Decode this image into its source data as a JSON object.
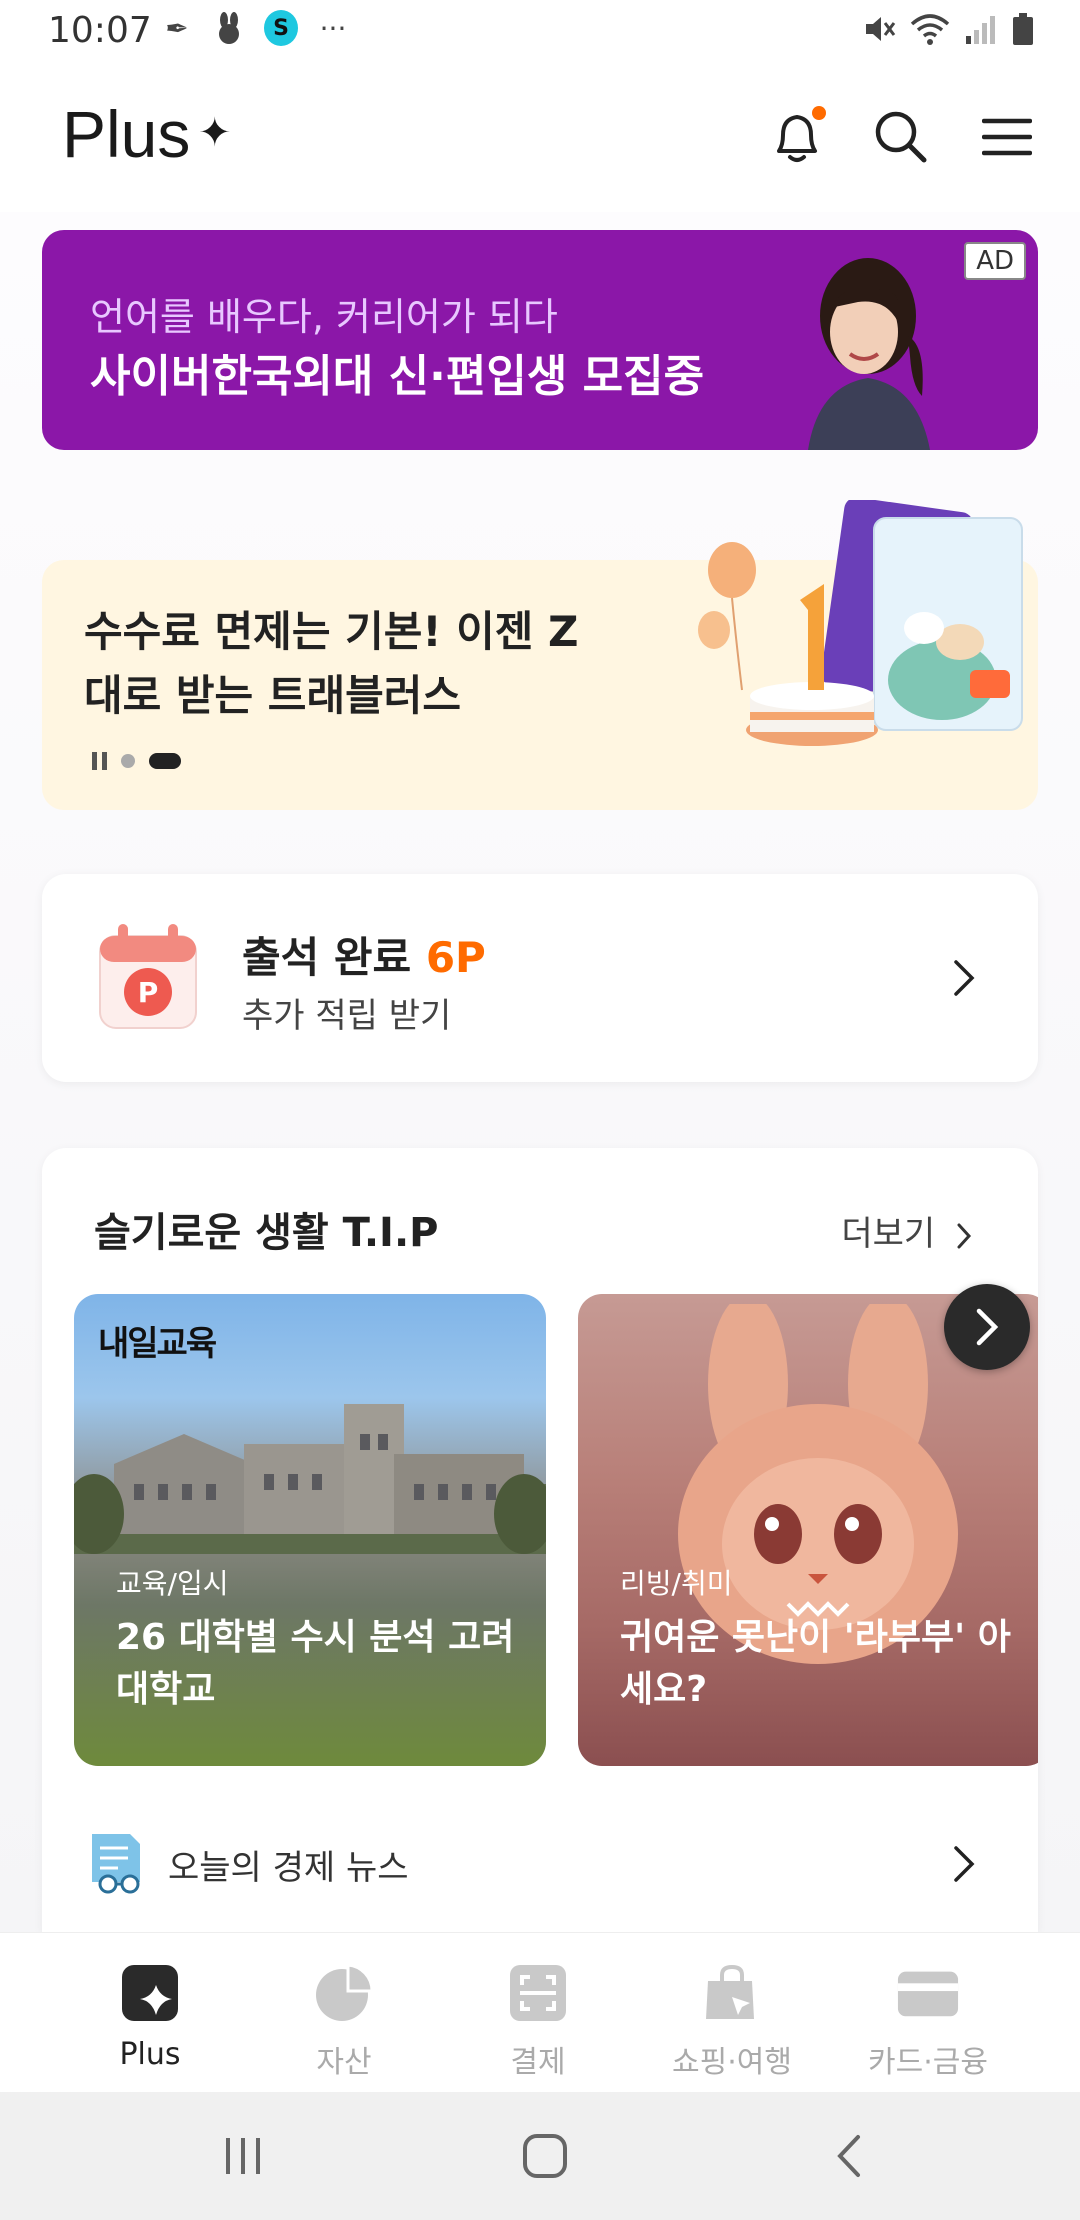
{
  "status_bar": {
    "time": "10:07"
  },
  "header": {
    "logo": "Plus",
    "logo_mark": "✦"
  },
  "ad_banner": {
    "subtitle": "언어를 배우다, 커리어가 되다",
    "title": "사이버한국외대 신·편입생 모집중",
    "badge": "AD"
  },
  "promo": {
    "title": "수수료 면제는 기본! 이젠 Z대로 받는 트래블러스"
  },
  "attendance": {
    "title": "출석 완료",
    "points": "6P",
    "subtitle": "추가 적립 받기"
  },
  "tips": {
    "title": "슬기로운 생활 T.I.P",
    "more_label": "더보기",
    "cards": [
      {
        "brand": "내일교육",
        "category": "교육/입시",
        "text": "26 대학별 수시 분석 고려대학교"
      },
      {
        "brand": "",
        "category": "리빙/취미",
        "text": "귀여운 못난이 '라부부' 아세요?"
      }
    ],
    "news_label": "오늘의 경제 뉴스"
  },
  "bottom_nav": {
    "items": [
      {
        "label": "Plus",
        "icon": "plus-sparkle-icon",
        "active": true
      },
      {
        "label": "자산",
        "icon": "pie-chart-icon",
        "active": false
      },
      {
        "label": "결제",
        "icon": "scan-icon",
        "active": false
      },
      {
        "label": "쇼핑·여행",
        "icon": "shopping-bag-icon",
        "active": false
      },
      {
        "label": "카드·금융",
        "icon": "card-icon",
        "active": false
      }
    ]
  },
  "colors": {
    "ad_purple": "#8b17a8",
    "accent_orange": "#ff6b00",
    "promo_bg": "#fff6e1"
  }
}
